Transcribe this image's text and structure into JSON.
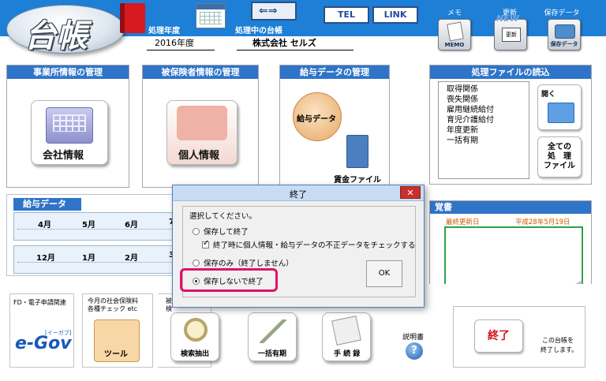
{
  "header": {
    "logo_text": "台帳",
    "period_label": "処理年度",
    "current_ledger_label": "処理中の台帳",
    "fiscal_year": "2016年度",
    "company": "株式会社 セルズ",
    "tel_button": "TEL",
    "link_button": "LINK",
    "memo_caption": "メモ",
    "update_caption": "更新",
    "save_caption": "保存データ",
    "memo_icon_text": "MEMO",
    "update_icon_text": "NEW",
    "update_icon_sub": "更新",
    "save_icon_text": "保存データ"
  },
  "panels": {
    "office": {
      "title": "事業所情報の管理",
      "button": "会社情報"
    },
    "insured": {
      "title": "被保険者情報の管理",
      "button": "個人情報"
    },
    "payroll": {
      "title": "給与データの管理",
      "button": "給与データ",
      "file": "賃金ファイル"
    },
    "files": {
      "title": "処理ファイルの読込",
      "items": [
        "取得関係",
        "喪失関係",
        "雇用継続給付",
        "育児介護給付",
        "年度更新",
        "一括有期"
      ],
      "open_button": "開く",
      "all_button_lines": [
        "全ての",
        "処　理",
        "ファイル"
      ]
    }
  },
  "salary": {
    "title": "給与データ",
    "row1": [
      "4月",
      "5月",
      "6月",
      "7"
    ],
    "row2": [
      "12月",
      "1月",
      "2月",
      "3"
    ]
  },
  "memo": {
    "title": "覚書",
    "last_updated_label": "最終更新日",
    "last_updated_value": "平成28年5月19日"
  },
  "dialog": {
    "title": "終了",
    "close": "✕",
    "prompt": "選択してください。",
    "options": [
      {
        "label": "保存して終了",
        "selected": false
      },
      {
        "label": "保存のみ（終了しません）",
        "selected": false
      },
      {
        "label": "保存しないで終了",
        "selected": true
      }
    ],
    "check_label": "終了時に個人情報・給与データの不正データをチェックする",
    "check_checked": true,
    "ok": "OK"
  },
  "footer": {
    "egov_caption": "FD・電子申請関連",
    "egov_logo": "e-Gov",
    "egov_ruby": "[イーガブ]",
    "tools_caption_1": "今月の社会保険料",
    "tools_caption_2": "各種チェック etc",
    "tools_button": "ツール",
    "partial_caption_1": "被",
    "partial_caption_2": "検",
    "search_button": "検索抽出",
    "bulk_button": "一括有期",
    "procedure_button": "手 続 録",
    "manual_label": "説明書",
    "exit_button": "終了",
    "exit_note_1": "この台帳を",
    "exit_note_2": "終了します。"
  }
}
